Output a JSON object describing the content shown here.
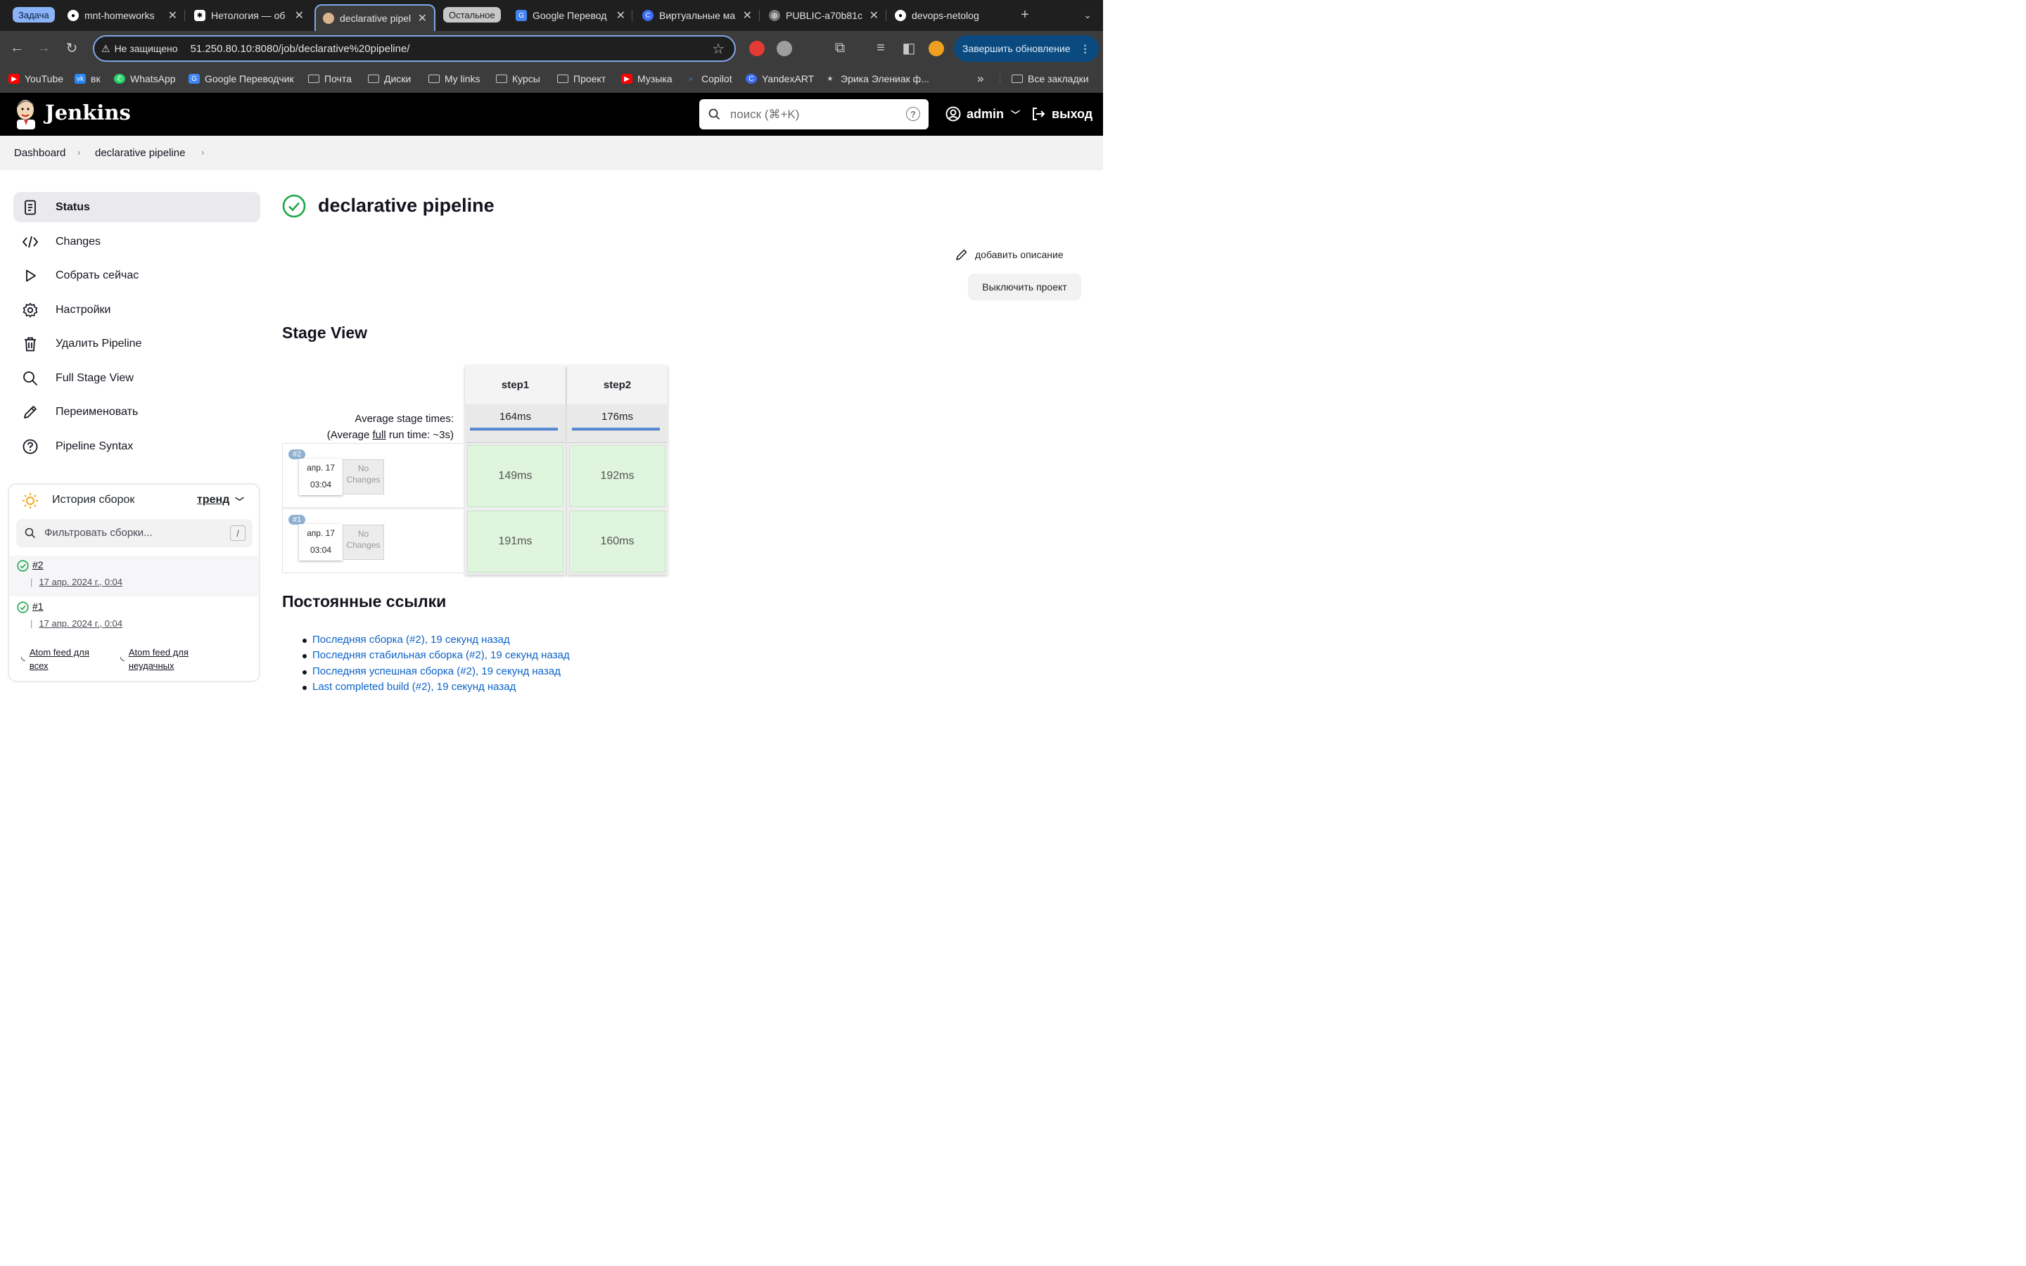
{
  "browser": {
    "tabs": [
      {
        "label": "mnt-homeworks"
      },
      {
        "label": "Нетология — об"
      },
      {
        "label": "declarative pipel"
      },
      {
        "label": "Google Перевод"
      },
      {
        "label": "Виртуальные ма"
      },
      {
        "label": "PUBLIC-a70b81c"
      },
      {
        "label": "devops-netolog"
      }
    ],
    "group_task": "Задача",
    "group_other": "Остальное",
    "not_secure": "Не защищено",
    "url": "51.250.80.10:8080/job/declarative%20pipeline/",
    "update_button": "Завершить обновление",
    "bookmarks": [
      {
        "label": "YouTube"
      },
      {
        "label": "вк"
      },
      {
        "label": "WhatsApp"
      },
      {
        "label": "Google Переводчик"
      },
      {
        "label": "Почта"
      },
      {
        "label": "Диски"
      },
      {
        "label": "My links"
      },
      {
        "label": "Курсы"
      },
      {
        "label": "Проект"
      },
      {
        "label": "Музыка"
      },
      {
        "label": "Copilot"
      },
      {
        "label": "YandexART"
      },
      {
        "label": "Эрика Элениак ф..."
      }
    ],
    "all_bookmarks": "Все закладки",
    "more": "»"
  },
  "header": {
    "logo_text": "Jenkins",
    "search_placeholder": "поиск (⌘+K)",
    "search_help": "?",
    "user": "admin",
    "logout": "выход"
  },
  "breadcrumb": {
    "items": [
      "Dashboard",
      "declarative pipeline"
    ]
  },
  "sidebar": {
    "items": [
      {
        "label": "Status"
      },
      {
        "label": "Changes"
      },
      {
        "label": "Собрать сейчас"
      },
      {
        "label": "Настройки"
      },
      {
        "label": "Удалить Pipeline"
      },
      {
        "label": "Full Stage View"
      },
      {
        "label": "Переименовать"
      },
      {
        "label": "Pipeline Syntax"
      }
    ]
  },
  "history": {
    "title": "История сборок",
    "trend": "тренд",
    "filter_placeholder": "Фильтровать сборки...",
    "filter_key": "/",
    "builds": [
      {
        "num": "#2",
        "date": "17 апр. 2024 г., 0:04"
      },
      {
        "num": "#1",
        "date": "17 апр. 2024 г., 0:04"
      }
    ],
    "feed_all": [
      "Atom feed для",
      "всех"
    ],
    "feed_failed": [
      "Atom feed для",
      "неудачных"
    ]
  },
  "main": {
    "title": "declarative pipeline",
    "add_description": "добавить описание",
    "disable_project": "Выключить проект",
    "stage_view_title": "Stage View",
    "avg_label_line1": "Average stage times:",
    "avg_label_pre": "(Average ",
    "avg_label_link": "full",
    "avg_label_post": " run time: ~3s)",
    "stages": [
      {
        "name": "step1",
        "avg": "164ms"
      },
      {
        "name": "step2",
        "avg": "176ms"
      }
    ],
    "runs": [
      {
        "badge": "#2",
        "date": "апр. 17",
        "time": "03:04",
        "changes_line1": "No",
        "changes_line2": "Changes",
        "durations": [
          "149ms",
          "192ms"
        ]
      },
      {
        "badge": "#1",
        "date": "апр. 17",
        "time": "03:04",
        "changes_line1": "No",
        "changes_line2": "Changes",
        "durations": [
          "191ms",
          "160ms"
        ]
      }
    ],
    "permalinks_title": "Постоянные ссылки",
    "permalinks": [
      "Последняя сборка (#2), 19 секунд назад",
      "Последняя стабильная сборка (#2), 19 секунд назад",
      "Последняя успешная сборка (#2), 19 секунд назад",
      "Last completed build (#2), 19 секунд назад"
    ]
  },
  "colors": {
    "success": "#1ea64b",
    "link": "#0b63c9",
    "stage_success": "#dff5dd",
    "header_bg": "#000000"
  }
}
